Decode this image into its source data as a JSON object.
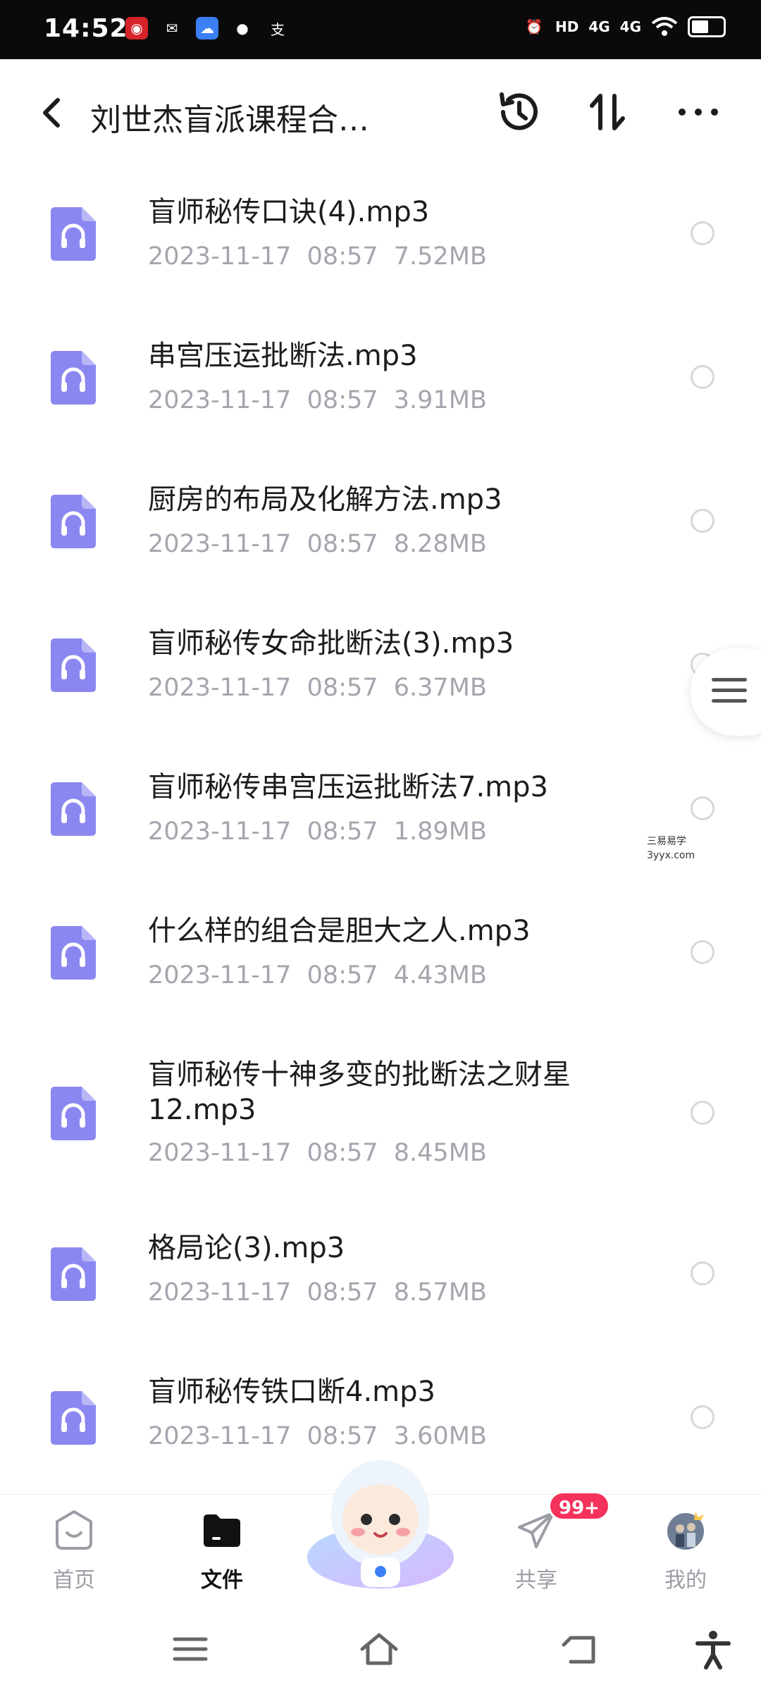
{
  "status_bar": {
    "time": "14:52",
    "hd_label": "HD",
    "signal1": "4G",
    "signal2": "4G",
    "battery_level": 0.55
  },
  "header": {
    "title": "刘世杰盲派课程合…"
  },
  "files": [
    {
      "name": "盲师秘传口诀(4).mp3",
      "meta": "2023-11-17  08:57  7.52MB"
    },
    {
      "name": "串宫压运批断法.mp3",
      "meta": "2023-11-17  08:57  3.91MB"
    },
    {
      "name": "厨房的布局及化解方法.mp3",
      "meta": "2023-11-17  08:57  8.28MB"
    },
    {
      "name": "盲师秘传女命批断法(3).mp3",
      "meta": "2023-11-17  08:57  6.37MB"
    },
    {
      "name": "盲师秘传串宫压运批断法7.mp3",
      "meta": "2023-11-17  08:57  1.89MB"
    },
    {
      "name": "什么样的组合是胆大之人.mp3",
      "meta": "2023-11-17  08:57  4.43MB"
    },
    {
      "name": "盲师秘传十神多变的批断法之财星",
      "name2": "12.mp3",
      "meta": "2023-11-17  08:57  8.45MB"
    },
    {
      "name": "格局论(3).mp3",
      "meta": "2023-11-17  08:57  8.57MB"
    },
    {
      "name": "盲师秘传铁口断4.mp3",
      "meta": "2023-11-17  08:57  3.60MB"
    }
  ],
  "watermark": {
    "line1": "三易易学",
    "line2": "3yyx.com"
  },
  "bottom_nav": {
    "home": "首页",
    "files": "文件",
    "share": "共享",
    "mine": "我的",
    "share_badge": "99+"
  },
  "colors": {
    "file_icon": "#8b87f0",
    "accent_badge": "#f4325b"
  }
}
